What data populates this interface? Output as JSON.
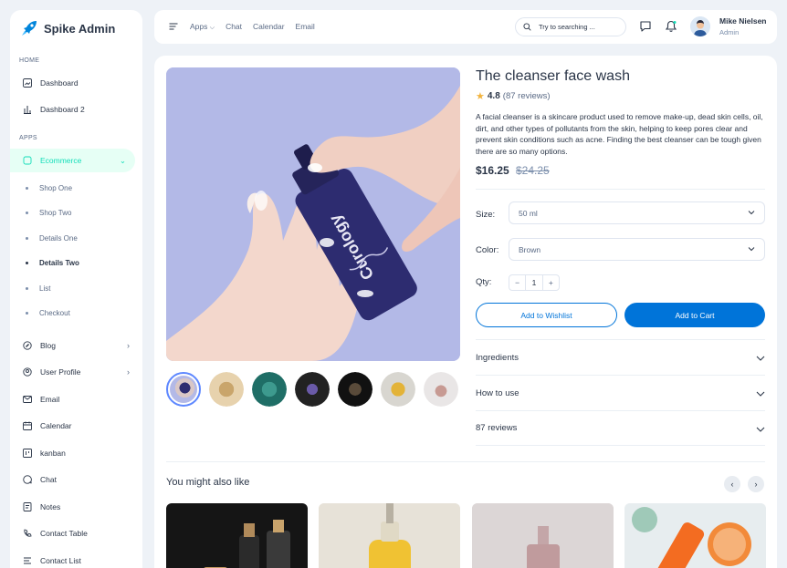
{
  "brand": {
    "name": "Spike Admin"
  },
  "sidebar": {
    "caption_home": "HOME",
    "caption_apps": "APPS",
    "items": [
      {
        "label": "Dashboard"
      },
      {
        "label": "Dashboard 2"
      },
      {
        "label": "Ecommerce"
      },
      {
        "label": "Blog"
      },
      {
        "label": "User Profile"
      },
      {
        "label": "Email"
      },
      {
        "label": "Calendar"
      },
      {
        "label": "kanban"
      },
      {
        "label": "Chat"
      },
      {
        "label": "Notes"
      },
      {
        "label": "Contact Table"
      },
      {
        "label": "Contact List"
      }
    ],
    "sub_items": [
      {
        "label": "Shop One"
      },
      {
        "label": "Shop Two"
      },
      {
        "label": "Details One"
      },
      {
        "label": "Details Two"
      },
      {
        "label": "List"
      },
      {
        "label": "Checkout"
      }
    ]
  },
  "topbar": {
    "links": [
      "Apps",
      "Chat",
      "Calendar",
      "Email"
    ],
    "search_placeholder": "Try to searching ...",
    "user_name": "Mike Nielsen",
    "user_role": "Admin"
  },
  "product": {
    "title": "The cleanser face wash",
    "rating": "4.8",
    "reviews": "(87 reviews)",
    "description": "A facial cleanser is a skincare product used to remove make-up, dead skin cells, oil, dirt, and other types of pollutants from the skin, helping to keep pores clear and prevent skin conditions such as acne. Finding the best cleanser can be tough given there are so many options.",
    "price": "$16.25",
    "old_price": "$24.25",
    "bottle_text": "Curology",
    "size_label": "Size:",
    "size_value": "50 ml",
    "color_label": "Color:",
    "color_value": "Brown",
    "qty_label": "Qty:",
    "qty_minus": "−",
    "qty_value": "1",
    "qty_plus": "+",
    "wishlist_label": "Add to Wishlist",
    "cart_label": "Add to Cart"
  },
  "accordion": [
    "Ingredients",
    "How to use",
    "87 reviews"
  ],
  "also_like": {
    "title": "You might also like",
    "prev": "‹",
    "next": "›"
  },
  "colors": {
    "primary": "#0074d9",
    "accent": "#13deb9",
    "active_bg": "#e6fff5"
  }
}
